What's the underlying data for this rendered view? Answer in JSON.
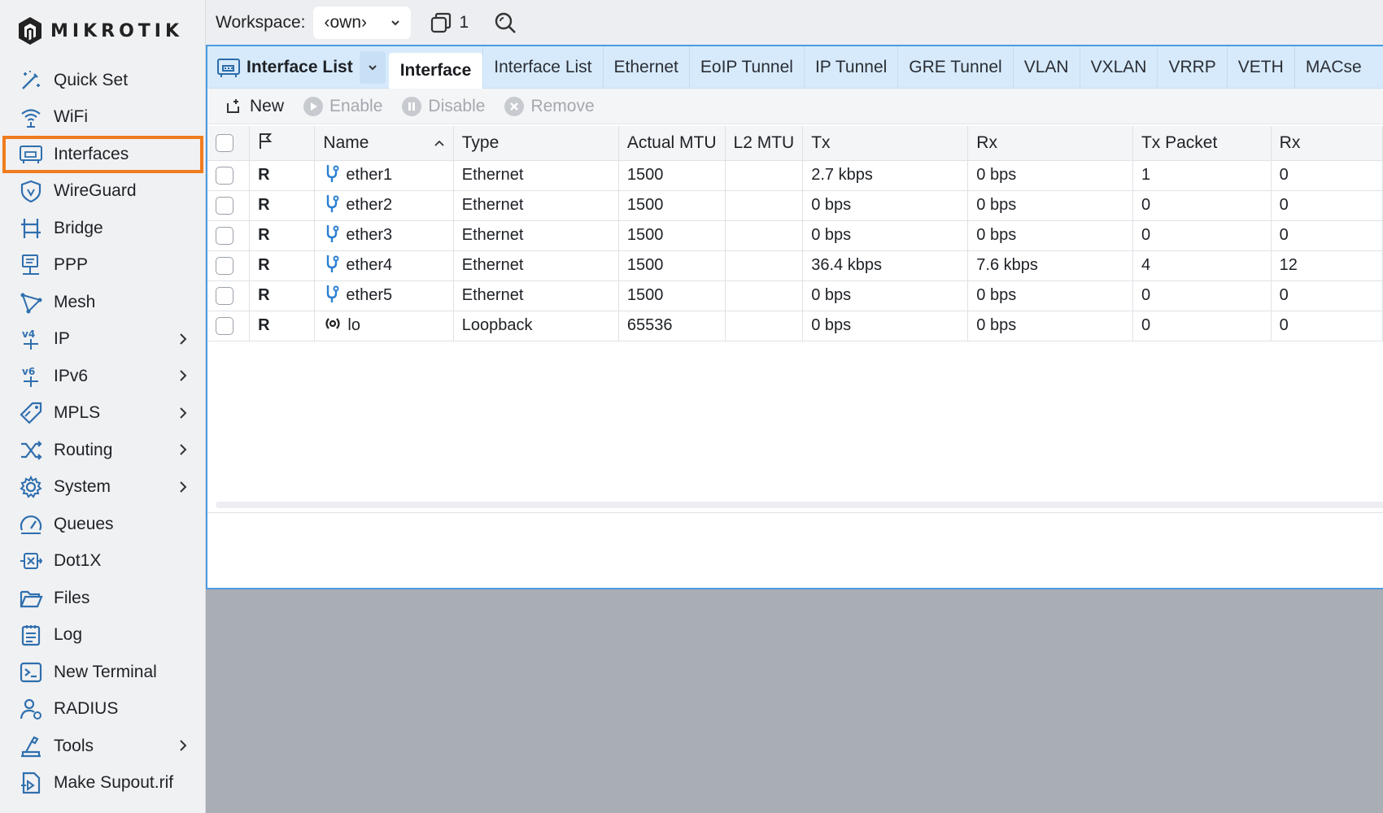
{
  "brand": {
    "logo_text": "MIKROTIK"
  },
  "sidebar": {
    "items": [
      {
        "label": "Quick Set",
        "icon": "wand-icon",
        "chevron": false
      },
      {
        "label": "WiFi",
        "icon": "wifi-icon",
        "chevron": false
      },
      {
        "label": "Interfaces",
        "icon": "interface-icon",
        "chevron": false,
        "active": true
      },
      {
        "label": "WireGuard",
        "icon": "shield-icon",
        "chevron": false
      },
      {
        "label": "Bridge",
        "icon": "bridge-icon",
        "chevron": false
      },
      {
        "label": "PPP",
        "icon": "ppp-icon",
        "chevron": false
      },
      {
        "label": "Mesh",
        "icon": "mesh-icon",
        "chevron": false
      },
      {
        "label": "IP",
        "icon": "ipv4-icon",
        "chevron": true
      },
      {
        "label": "IPv6",
        "icon": "ipv6-icon",
        "chevron": true
      },
      {
        "label": "MPLS",
        "icon": "tag-icon",
        "chevron": true
      },
      {
        "label": "Routing",
        "icon": "routing-icon",
        "chevron": true
      },
      {
        "label": "System",
        "icon": "gear-icon",
        "chevron": true
      },
      {
        "label": "Queues",
        "icon": "gauge-icon",
        "chevron": false
      },
      {
        "label": "Dot1X",
        "icon": "dot1x-icon",
        "chevron": false
      },
      {
        "label": "Files",
        "icon": "folder-icon",
        "chevron": false
      },
      {
        "label": "Log",
        "icon": "log-icon",
        "chevron": false
      },
      {
        "label": "New Terminal",
        "icon": "terminal-icon",
        "chevron": false
      },
      {
        "label": "RADIUS",
        "icon": "radius-icon",
        "chevron": false
      },
      {
        "label": "Tools",
        "icon": "tools-icon",
        "chevron": true
      },
      {
        "label": "Make Supout.rif",
        "icon": "supout-icon",
        "chevron": false
      }
    ]
  },
  "topbar": {
    "workspace_label": "Workspace:",
    "workspace_value": "‹own›",
    "window_count": "1"
  },
  "panel": {
    "title": "Interface List",
    "tabs": [
      "Interface",
      "Interface List",
      "Ethernet",
      "EoIP Tunnel",
      "IP Tunnel",
      "GRE Tunnel",
      "VLAN",
      "VXLAN",
      "VRRP",
      "VETH",
      "MACse"
    ],
    "active_tab": "Interface",
    "toolbar": {
      "new_label": "New",
      "enable_label": "Enable",
      "disable_label": "Disable",
      "remove_label": "Remove"
    }
  },
  "table": {
    "columns": [
      "",
      "",
      "Name",
      "Type",
      "Actual MTU",
      "L2 MTU",
      "Tx",
      "Rx",
      "Tx Packet",
      "Rx"
    ],
    "rows": [
      {
        "flag": "R",
        "name": "ether1",
        "type": "Ethernet",
        "actual_mtu": "1500",
        "l2_mtu": "",
        "tx": "2.7 kbps",
        "rx": "0 bps",
        "tx_packet": "1",
        "rx_packet": "0",
        "icon": "ethernet-icon"
      },
      {
        "flag": "R",
        "name": "ether2",
        "type": "Ethernet",
        "actual_mtu": "1500",
        "l2_mtu": "",
        "tx": "0 bps",
        "rx": "0 bps",
        "tx_packet": "0",
        "rx_packet": "0",
        "icon": "ethernet-icon"
      },
      {
        "flag": "R",
        "name": "ether3",
        "type": "Ethernet",
        "actual_mtu": "1500",
        "l2_mtu": "",
        "tx": "0 bps",
        "rx": "0 bps",
        "tx_packet": "0",
        "rx_packet": "0",
        "icon": "ethernet-icon"
      },
      {
        "flag": "R",
        "name": "ether4",
        "type": "Ethernet",
        "actual_mtu": "1500",
        "l2_mtu": "",
        "tx": "36.4 kbps",
        "rx": "7.6 kbps",
        "tx_packet": "4",
        "rx_packet": "12",
        "icon": "ethernet-icon"
      },
      {
        "flag": "R",
        "name": "ether5",
        "type": "Ethernet",
        "actual_mtu": "1500",
        "l2_mtu": "",
        "tx": "0 bps",
        "rx": "0 bps",
        "tx_packet": "0",
        "rx_packet": "0",
        "icon": "ethernet-icon"
      },
      {
        "flag": "R",
        "name": "lo",
        "type": "Loopback",
        "actual_mtu": "65536",
        "l2_mtu": "",
        "tx": "0 bps",
        "rx": "0 bps",
        "tx_packet": "0",
        "rx_packet": "0",
        "icon": "loopback-icon"
      }
    ]
  },
  "colors": {
    "accent": "#2b7fd0",
    "active_outline": "#f07c1e",
    "tabbar_bg": "#d7eafb",
    "workspace_bg": "#a9adb4"
  }
}
